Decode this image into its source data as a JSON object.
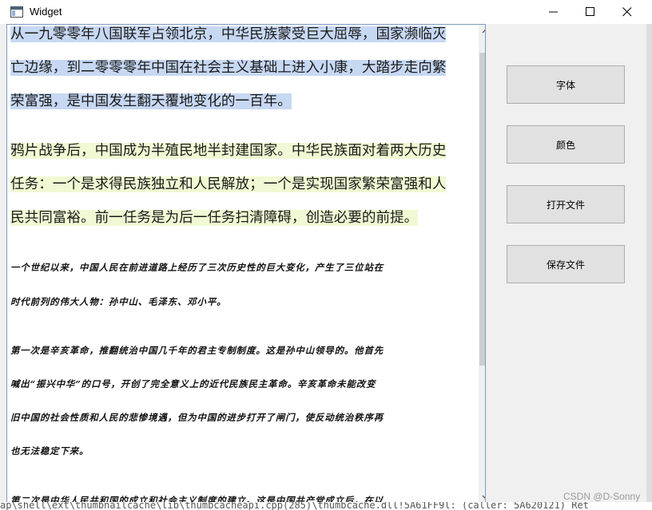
{
  "window": {
    "title": "Widget",
    "controls": [
      "minimize-icon",
      "maximize-icon",
      "close-icon"
    ]
  },
  "editor": {
    "paragraph_1": {
      "highlight_color": "#c7d8f3",
      "lines": [
        "从一九零零年八国联军占领北京，中华民族蒙受巨大屈辱，国家濒临灭",
        "亡边缘，到二零零零年中国在社会主义基础上进入小康，大踏步走向繁",
        "荣富强，是中国发生翻天覆地变化的一百年。"
      ]
    },
    "paragraph_2": {
      "highlight_color": "#f0f9d3",
      "lines": [
        "鸦片战争后，中国成为半殖民地半封建国家。中华民族面对着两大历史",
        "任务：一个是求得民族独立和人民解放；一个是实现国家繁荣富强和人",
        "民共同富裕。前一任务是为后一任务扫清障碍，创造必要的前提。"
      ]
    },
    "paragraph_3": {
      "lines": [
        "一个世纪以来，中国人民在前进道路上经历了三次历史性的巨大变化，产生了三位站在",
        "时代前列的伟大人物：孙中山、毛泽东、邓小平。",
        "第一次是辛亥革命，推翻统治中国几千年的君主专制制度。这是孙中山领导的。他首先",
        "喊出“振兴中华”的口号，开创了完全意义上的近代民族民主革命。辛亥革命未能改变",
        "旧中国的社会性质和人民的悲惨境遇，但为中国的进步打开了闸门，使反动统治秩序再",
        "也无法稳定下来。",
        "第二次是中华人民共和国的成立和社会主义制度的建立。这是中国共产党成立后，在以"
      ]
    }
  },
  "buttons": {
    "font": "字体",
    "color": "颜色",
    "open_file": "打开文件",
    "save_file": "保存文件"
  },
  "bottom_text": "ap\\shell\\ext\\thumbnailcache\\lib\\thumbcacheapi.cpp(285)\\thumbcache.dll!5A61FF9l: (caller: 5A620121) Ret",
  "watermark": "CSDN @D-Sonny"
}
